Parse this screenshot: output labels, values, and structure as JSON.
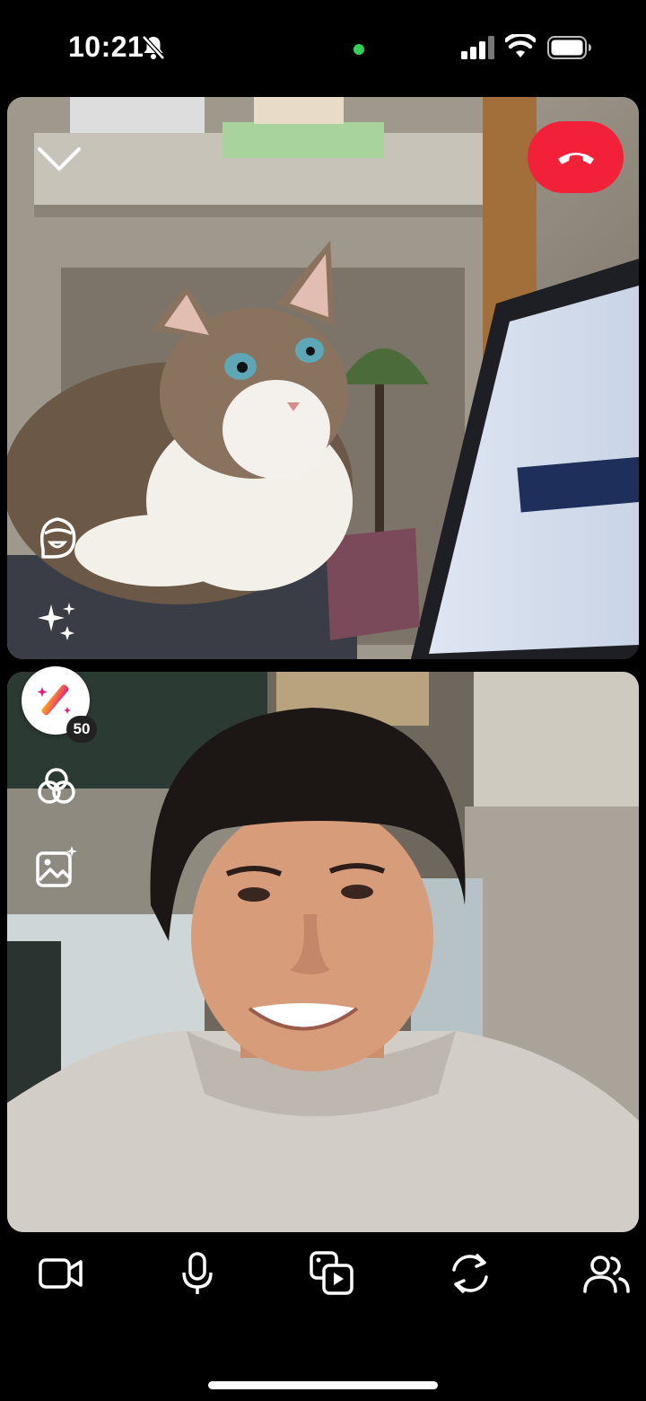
{
  "status_bar": {
    "time": "10:21",
    "mic_indicator_color": "#30d158"
  },
  "call": {
    "end_call_color": "#f3203a",
    "lens_badge_count": "50"
  },
  "icons": {
    "collapse": "chevron-down-icon",
    "end_call": "phone-hangup-icon",
    "bitmoji": "bitmoji-face-icon",
    "effects": "sparkles-icon",
    "lens": "magic-wand-icon",
    "filters": "filters-circles-icon",
    "backgrounds": "image-sparkle-icon",
    "video": "video-camera-icon",
    "mic": "microphone-icon",
    "media": "media-share-icon",
    "flip": "flip-camera-icon",
    "participants": "participants-icon"
  }
}
